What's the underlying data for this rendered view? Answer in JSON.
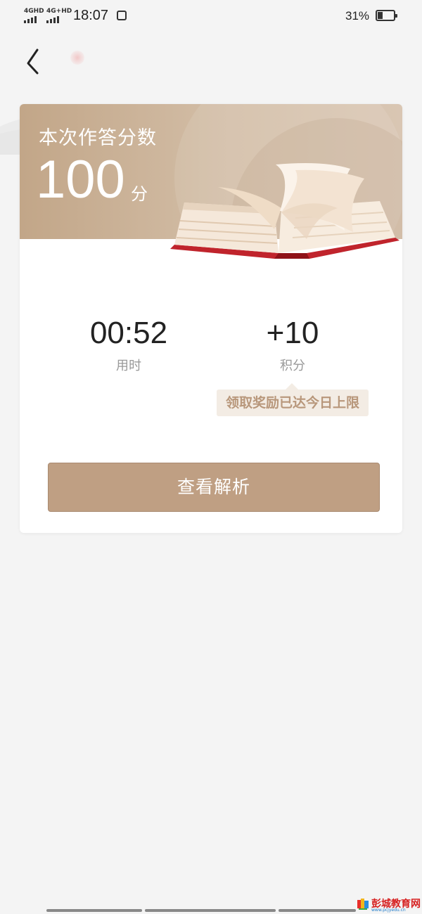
{
  "status_bar": {
    "signal1": "4GHD",
    "signal2": "4G+HD",
    "time": "18:07",
    "battery": "31%"
  },
  "result": {
    "title": "本次作答分数",
    "score": "100",
    "unit": "分"
  },
  "stats": {
    "time_value": "00:52",
    "time_label": "用时",
    "points_value": "+10",
    "points_label": "积分"
  },
  "tooltip": "领取奖励已达今日上限",
  "view_button": "查看解析",
  "watermark": {
    "text": "彭城教育网",
    "url": "www.pcjyedu.cn"
  },
  "colors": {
    "header": "#c2a688",
    "button": "#bf9f83",
    "tooltip_text": "#b8977b",
    "book_cover": "#c0242c"
  }
}
